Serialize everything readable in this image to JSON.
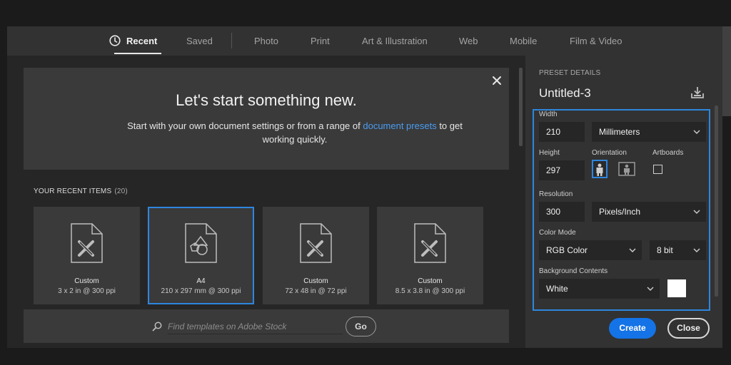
{
  "tabs": [
    {
      "label": "Recent",
      "active": true
    },
    {
      "label": "Saved"
    },
    {
      "label": "Photo"
    },
    {
      "label": "Print"
    },
    {
      "label": "Art & Illustration"
    },
    {
      "label": "Web"
    },
    {
      "label": "Mobile"
    },
    {
      "label": "Film & Video"
    }
  ],
  "hero": {
    "title": "Let's start something new.",
    "subtitle_before": "Start with your own document settings or from a range of ",
    "subtitle_link": "document presets",
    "subtitle_after": " to get working quickly."
  },
  "recent": {
    "heading": "YOUR RECENT ITEMS",
    "count": "(20)",
    "items": [
      {
        "name": "Custom",
        "desc": "3 x 2 in @ 300 ppi",
        "icon": "document-brush-icon"
      },
      {
        "name": "A4",
        "desc": "210 x 297 mm @ 300 ppi",
        "icon": "document-shapes-icon",
        "selected": true
      },
      {
        "name": "Custom",
        "desc": "72 x 48 in @ 72 ppi",
        "icon": "document-brush-icon"
      },
      {
        "name": "Custom",
        "desc": "8.5 x 3.8 in @ 300 ppi",
        "icon": "document-brush-icon"
      }
    ]
  },
  "search": {
    "placeholder": "Find templates on Adobe Stock",
    "go_label": "Go"
  },
  "preset": {
    "heading": "PRESET DETAILS",
    "doc_name": "Untitled-3",
    "width_label": "Width",
    "width_value": "210",
    "unit": "Millimeters",
    "height_label": "Height",
    "height_value": "297",
    "orientation_label": "Orientation",
    "orientation_selected": "portrait",
    "artboards_label": "Artboards",
    "artboards_checked": false,
    "resolution_label": "Resolution",
    "resolution_value": "300",
    "resolution_unit": "Pixels/Inch",
    "color_mode_label": "Color Mode",
    "color_mode": "RGB Color",
    "bit_depth": "8 bit",
    "background_label": "Background Contents",
    "background": "White",
    "background_swatch": "#ffffff"
  },
  "actions": {
    "create_label": "Create",
    "close_label": "Close"
  },
  "colors": {
    "accent": "#2e86de",
    "create_button": "#1473e6",
    "dialog_bg": "#323232",
    "panel_bg": "#3a3a3a",
    "field_bg": "#262626"
  }
}
